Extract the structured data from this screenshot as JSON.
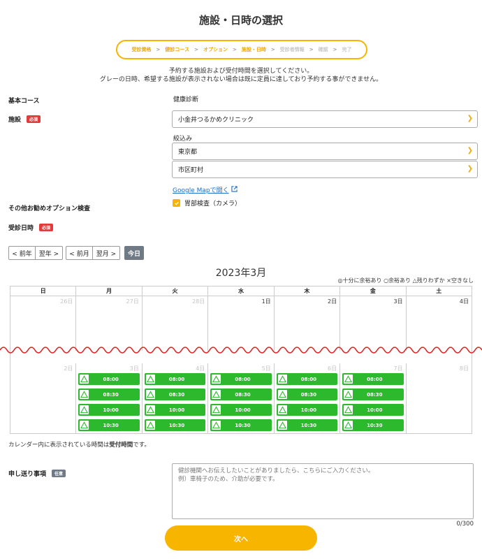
{
  "page": {
    "title": "施設・日時の選択"
  },
  "steps": [
    {
      "label": "受診資格",
      "active": true
    },
    {
      "label": "健診コース",
      "active": true
    },
    {
      "label": "オプション",
      "active": true
    },
    {
      "label": "施設・日時",
      "active": true
    },
    {
      "label": "受診者情報",
      "active": false
    },
    {
      "label": "確認",
      "active": false
    },
    {
      "label": "完了",
      "active": false
    }
  ],
  "intro": {
    "line1": "予約する施設および受付時間を選択してください。",
    "line2": "グレーの日時、希望する施設が表示されない場合は既に定員に達しており予約する事ができません。"
  },
  "course": {
    "label": "基本コース",
    "value": "健康診断"
  },
  "facility": {
    "label": "施設",
    "badge": "必須",
    "selected": "小金井つるかめクリニック",
    "filter_label": "絞込み",
    "prefecture": "東京都",
    "city": "市区町村",
    "map_link": "Google Mapで開く"
  },
  "options": {
    "label": "その他お勧めオプション検査",
    "item": "胃部検査（カメラ）"
  },
  "date": {
    "label": "受診日時",
    "badge": "必須"
  },
  "nav": {
    "prev_year": "< 前年",
    "next_year": "翌年 >",
    "prev_month": "< 前月",
    "next_month": "翌月 >",
    "today": "今日"
  },
  "calendar": {
    "month_title": "2023年3月",
    "legend": "◎十分に余裕あり ○余裕あり △残りわずか ×空きなし",
    "weekdays": [
      "日",
      "月",
      "火",
      "水",
      "木",
      "金",
      "土"
    ],
    "week1": [
      {
        "day": "26日",
        "muted": true
      },
      {
        "day": "27日",
        "muted": true
      },
      {
        "day": "28日",
        "muted": true
      },
      {
        "day": "1日",
        "muted": false
      },
      {
        "day": "2日",
        "muted": false
      },
      {
        "day": "3日",
        "muted": false
      },
      {
        "day": "4日",
        "muted": false
      }
    ],
    "week2": [
      {
        "day": "2日",
        "slots": []
      },
      {
        "day": "3日",
        "slots": [
          "08:00",
          "08:30",
          "10:00",
          "10:30"
        ]
      },
      {
        "day": "4日",
        "slots": [
          "08:00",
          "08:30",
          "10:00",
          "10:30"
        ]
      },
      {
        "day": "5日",
        "slots": [
          "08:00",
          "08:30",
          "10:00",
          "10:30"
        ]
      },
      {
        "day": "6日",
        "slots": [
          "08:00",
          "08:30",
          "10:00",
          "10:30"
        ]
      },
      {
        "day": "7日",
        "slots": [
          "08:00",
          "08:30"
        ]
      },
      {
        "day": "8日",
        "slots": []
      }
    ],
    "week2_extra": {
      "day": "7日",
      "slots": [
        "10:00",
        "10:30"
      ]
    },
    "note_prefix": "カレンダー内に表示されている時間は",
    "note_bold": "受付時間",
    "note_suffix": "です。"
  },
  "message": {
    "label": "申し送り事項",
    "badge": "任意",
    "placeholder_line1": "健診機関へお伝えしたいことがありましたら、こちらにご入力ください。",
    "placeholder_line2": "例）車椅子のため、介助が必要です。",
    "counter": "0/300"
  },
  "next_button": "次へ",
  "colors": {
    "accent": "#f7b500",
    "slot": "#2db92d",
    "required": "#e33a3a",
    "link": "#1a6fc9"
  }
}
